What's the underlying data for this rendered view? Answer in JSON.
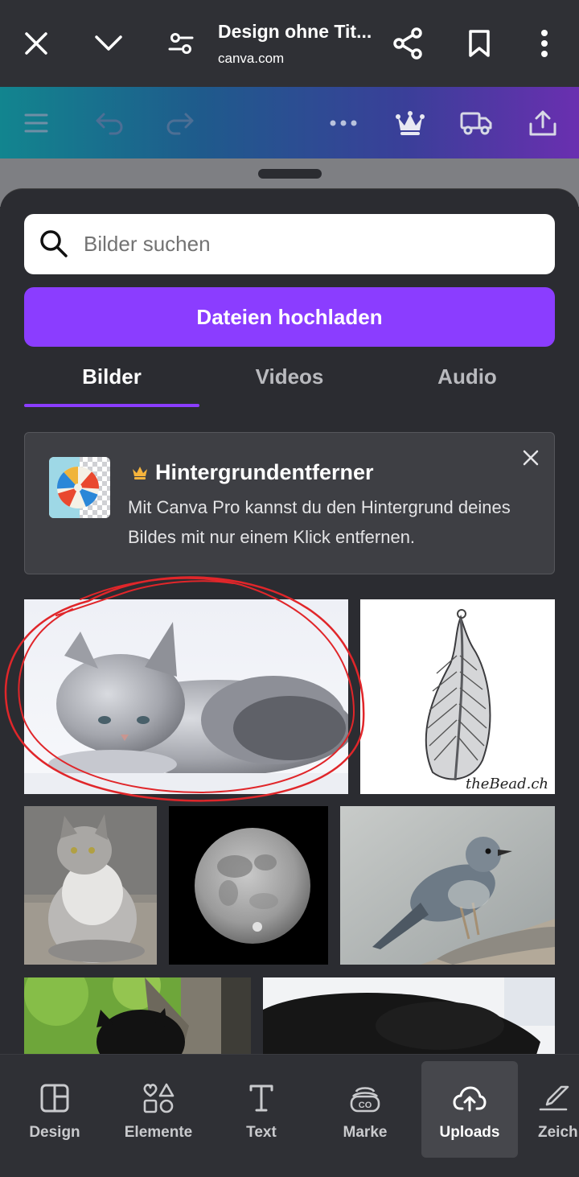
{
  "browser": {
    "title": "Design ohne Tit...",
    "url": "canva.com",
    "icons": [
      "close-icon",
      "chevron-down-icon",
      "page-settings-icon",
      "share-icon",
      "bookmark-icon",
      "more-vert-icon"
    ]
  },
  "editor_toolbar": {
    "icons": [
      "menu-icon",
      "undo-icon",
      "redo-icon",
      "more-horiz-icon",
      "crown-icon",
      "truck-icon",
      "export-icon"
    ]
  },
  "panel": {
    "search": {
      "placeholder": "Bilder suchen"
    },
    "upload_button": "Dateien hochladen",
    "tabs": [
      {
        "label": "Bilder",
        "active": true
      },
      {
        "label": "Videos",
        "active": false
      },
      {
        "label": "Audio",
        "active": false
      }
    ],
    "promo": {
      "title": "Hintergrundentferner",
      "text": "Mit Canva Pro kannst du den Hintergrund deines Bildes mit nur einem Klick entfernen."
    },
    "images": [
      {
        "name": "cat-lying-image",
        "highlighted": true
      },
      {
        "name": "feather-pendant-image",
        "caption": "theBead.ch"
      },
      {
        "name": "cat-sitting-image"
      },
      {
        "name": "moon-image"
      },
      {
        "name": "bird-image"
      },
      {
        "name": "black-cat-tree-image"
      },
      {
        "name": "black-cat-lying-image"
      }
    ]
  },
  "bottom_nav": [
    {
      "label": "Design",
      "icon": "design-icon",
      "active": false
    },
    {
      "label": "Elemente",
      "icon": "elements-icon",
      "active": false
    },
    {
      "label": "Text",
      "icon": "text-icon",
      "active": false
    },
    {
      "label": "Marke",
      "icon": "brand-icon",
      "active": false
    },
    {
      "label": "Uploads",
      "icon": "cloud-upload-icon",
      "active": true
    },
    {
      "label": "Zeich",
      "icon": "draw-icon",
      "active": false
    }
  ],
  "colors": {
    "accent": "#8b3dff",
    "annotation": "#e0262a",
    "panel_bg": "#2b2c31"
  }
}
